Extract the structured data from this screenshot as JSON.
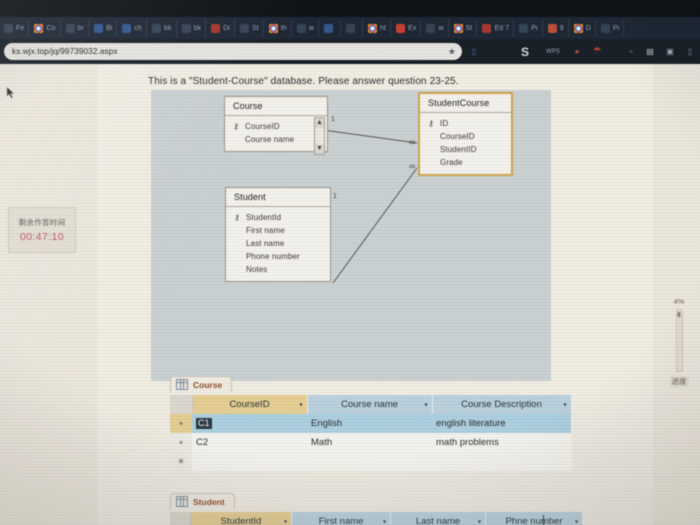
{
  "browser": {
    "url": "ks.wjx.top/jq/99739032.aspx",
    "star_icon": "★",
    "tabs": [
      {
        "label": "Fe",
        "icon": "favicon-generic"
      },
      {
        "label": "Co",
        "icon": "favicon-chrome"
      },
      {
        "label": "br",
        "icon": "favicon-generic"
      },
      {
        "label": "Bl",
        "icon": "favicon-blue"
      },
      {
        "label": "ch",
        "icon": "favicon-blue"
      },
      {
        "label": "bk",
        "icon": "favicon-generic"
      },
      {
        "label": "bk",
        "icon": "favicon-generic"
      },
      {
        "label": "Di",
        "icon": "favicon-red"
      },
      {
        "label": "St",
        "icon": "favicon-generic"
      },
      {
        "label": "th",
        "icon": "favicon-chrome"
      },
      {
        "label": "w",
        "icon": "favicon-generic"
      },
      {
        "label": "",
        "icon": "favicon-blue"
      },
      {
        "label": "",
        "icon": "favicon-generic"
      },
      {
        "label": "ht",
        "icon": "favicon-chrome"
      },
      {
        "label": "Ex",
        "icon": "favicon-powerpoint"
      },
      {
        "label": "w",
        "icon": "favicon-generic"
      },
      {
        "label": "St",
        "icon": "favicon-chrome"
      },
      {
        "label": "Ed  7",
        "icon": "favicon-red"
      },
      {
        "label": "Pi",
        "icon": "favicon-generic"
      },
      {
        "label": "9",
        "icon": "favicon-orange"
      },
      {
        "label": "D",
        "icon": "favicon-chrome"
      },
      {
        "label": "Pi",
        "icon": "favicon-generic"
      }
    ],
    "toolbar_icons": [
      "bookmark-icon",
      "s-logo-icon",
      "wps-icon",
      "dot-icon",
      "umbrella-icon",
      "small-dot-icon",
      "image-icon",
      "app-icon",
      "menu-icon"
    ]
  },
  "exam": {
    "timer_label": "剩余作答时间",
    "timer_value": "00:47:10",
    "progress_percent": "4%",
    "progress_label": "进度",
    "prompt": "This is a \"Student-Course\" database. Please answer question 23-25."
  },
  "relationships": {
    "tables": [
      {
        "name": "Course",
        "selected": false,
        "has_scrollbar": true,
        "fields": [
          {
            "label": "CourseID",
            "key": true
          },
          {
            "label": "Course name",
            "key": false
          }
        ]
      },
      {
        "name": "StudentCourse",
        "selected": true,
        "has_scrollbar": false,
        "fields": [
          {
            "label": "ID",
            "key": true
          },
          {
            "label": "CourseID",
            "key": false
          },
          {
            "label": "StudentID",
            "key": false
          },
          {
            "label": "Grade",
            "key": false
          }
        ]
      },
      {
        "name": "Student",
        "selected": false,
        "has_scrollbar": false,
        "fields": [
          {
            "label": "StudentId",
            "key": true
          },
          {
            "label": "First name",
            "key": false
          },
          {
            "label": "Last name",
            "key": false
          },
          {
            "label": "Phone number",
            "key": false
          },
          {
            "label": "Notes",
            "key": false
          }
        ]
      }
    ],
    "many_symbol": "∞",
    "one_symbol": "1"
  },
  "datasheets": [
    {
      "tab_label": "Course",
      "tab_icon": "datasheet-icon",
      "columns": [
        "CourseID",
        "Course name",
        "Course Description"
      ],
      "key_column_index": 0,
      "sort_caret": "▾",
      "expander_symbol": "+",
      "new_row_symbol": "✳",
      "selected_row_index": 0,
      "rows": [
        {
          "CourseID": "C1",
          "Course name": "English",
          "Course Description": "english literature"
        },
        {
          "CourseID": "C2",
          "Course name": "Math",
          "Course Description": "math problems"
        }
      ]
    },
    {
      "tab_label": "Student",
      "tab_icon": "datasheet-icon",
      "columns": [
        "StudentId",
        "First name",
        "Last name",
        "Phne number"
      ],
      "key_column_index": 0,
      "sort_caret": "▾",
      "expander_symbol": "+",
      "new_row_symbol": "✳",
      "selected_row_index": -1,
      "rows": []
    }
  ],
  "colors": {
    "header_blue": "#b9d4e3",
    "key_column": "#ecd08a",
    "selected_row": "#a9d3e7",
    "selected_table_border": "#d9a441",
    "timer_red": "#c9535a",
    "tab_text_orange": "#9a4a20",
    "canvas_bg": "#cbd3d4"
  }
}
